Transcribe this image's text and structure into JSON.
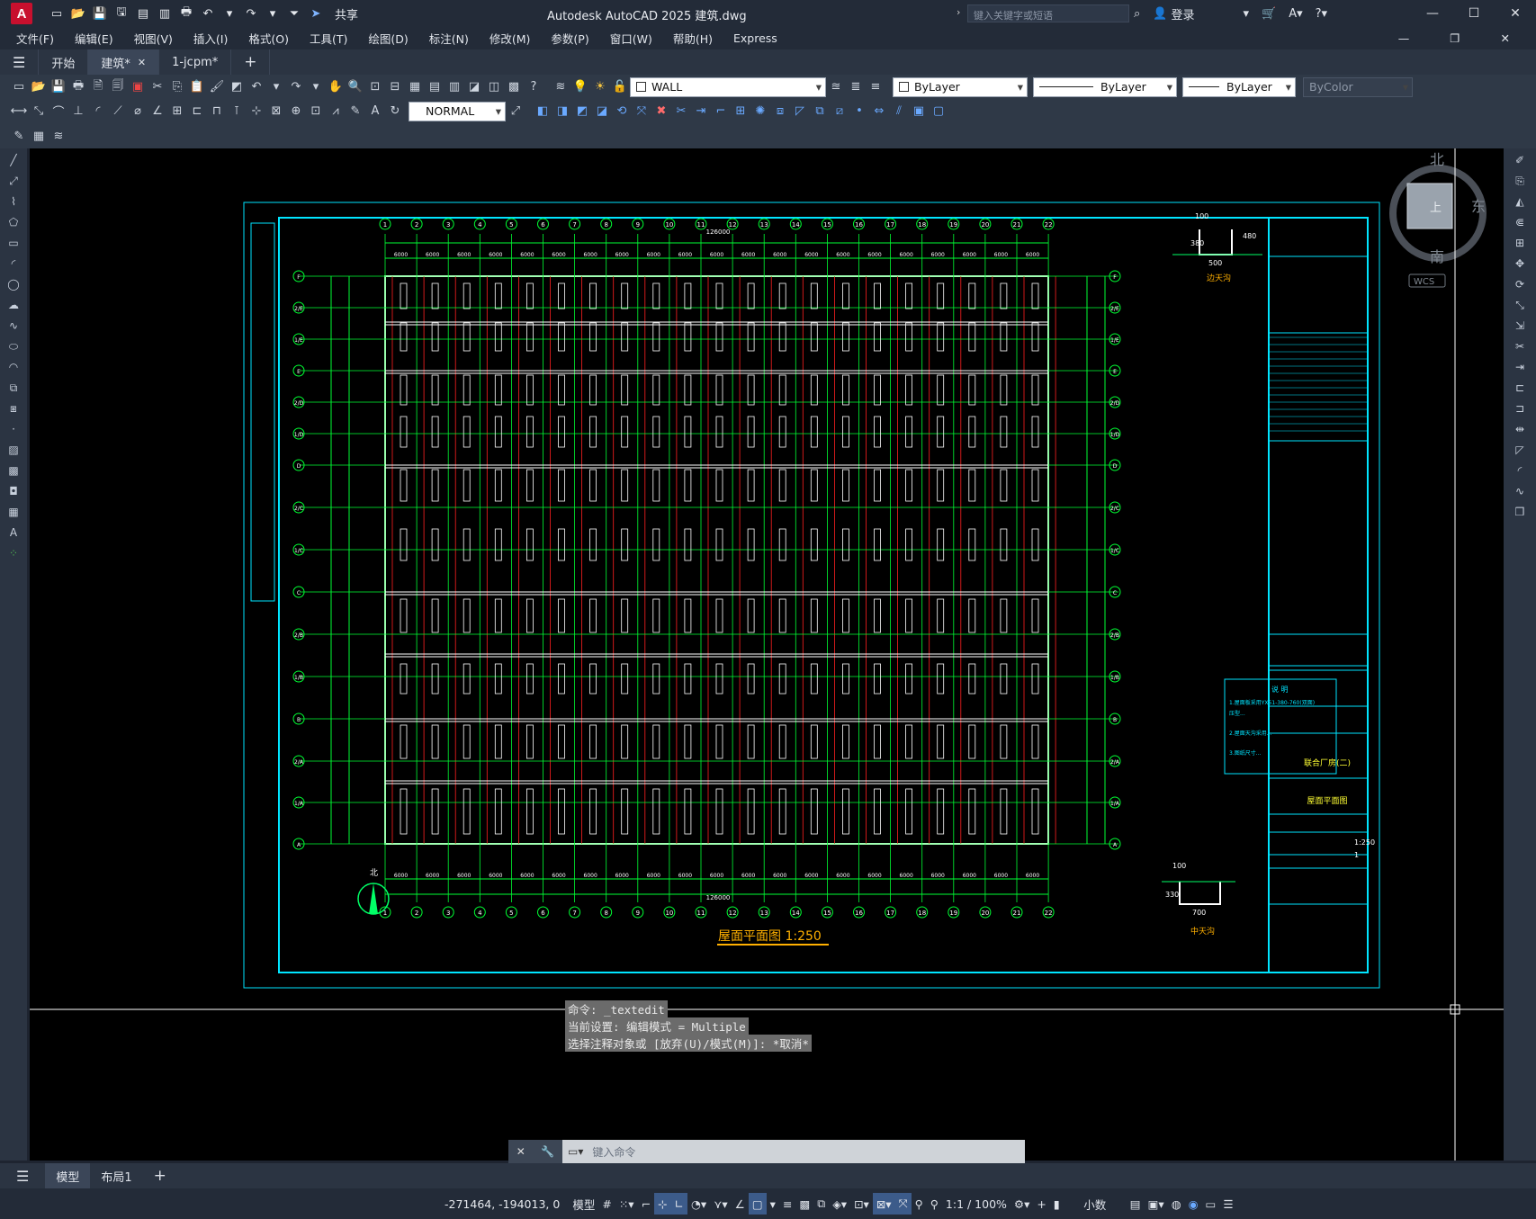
{
  "app": {
    "logo_letter": "A",
    "share_label": "共享",
    "title": "Autodesk AutoCAD 2025    建筑.dwg",
    "search_placeholder": "键入关键字或短语",
    "login_label": "登录"
  },
  "menu": [
    "文件(F)",
    "编辑(E)",
    "视图(V)",
    "插入(I)",
    "格式(O)",
    "工具(T)",
    "绘图(D)",
    "标注(N)",
    "修改(M)",
    "参数(P)",
    "窗口(W)",
    "帮助(H)",
    "Express"
  ],
  "tabs": [
    {
      "label": "开始",
      "active": false
    },
    {
      "label": "建筑*",
      "active": true
    },
    {
      "label": "1-jcpm*",
      "active": false
    }
  ],
  "toolbar": {
    "layer_name": "WALL",
    "color": "ByLayer",
    "linetype": "ByLayer",
    "lineweight": "ByLayer",
    "plotstyle": "ByColor",
    "text_style": "NORMAL"
  },
  "viewcube": {
    "north": "北",
    "south": "南",
    "east": "东",
    "face": "上",
    "wcs": "WCS"
  },
  "drawing": {
    "plan_title": "屋面平面图  1:250",
    "total_dim": "126000",
    "bay_dim": "6000",
    "col_labels": [
      "1",
      "2",
      "3",
      "4",
      "5",
      "6",
      "7",
      "8",
      "9",
      "10",
      "11",
      "12",
      "13",
      "14",
      "15",
      "16",
      "17",
      "18",
      "19",
      "20",
      "21",
      "22"
    ],
    "row_labels": [
      "F",
      "2/E",
      "1/E",
      "E",
      "2/D",
      "1/D",
      "D",
      "2/C",
      "1/C",
      "C",
      "2/B",
      "1/B",
      "B",
      "2/A",
      "1/A",
      "A"
    ],
    "north_label": "北",
    "gutter_detail_top": "边天沟",
    "gutter_detail_bottom": "中天沟",
    "gutter_top_dims": [
      "100",
      "500",
      "380",
      "480"
    ],
    "gutter_bottom_dims": [
      "100",
      "700",
      "330"
    ],
    "notes_title": "说 明",
    "notes": [
      "1.屋面板采用YX51-380-760(双面)",
      "  压型...",
      "2.屋面天沟采用...",
      "3.图纸尺寸..."
    ],
    "title_block": {
      "project": "联合厂房(二)",
      "drawing_name": "屋面平面图",
      "scale": "1:250",
      "sheet": "1"
    }
  },
  "command": {
    "history": [
      "命令:  _textedit",
      "当前设置: 编辑模式 = Multiple",
      "选择注释对象或 [放弃(U)/模式(M)]: *取消*"
    ],
    "placeholder": "键入命令"
  },
  "layouts": [
    {
      "label": "模型",
      "active": true
    },
    {
      "label": "布局1",
      "active": false
    }
  ],
  "status": {
    "coords": "-271464, -194013, 0",
    "model": "模型",
    "scale": "1:1 / 100%",
    "units": "小数"
  }
}
